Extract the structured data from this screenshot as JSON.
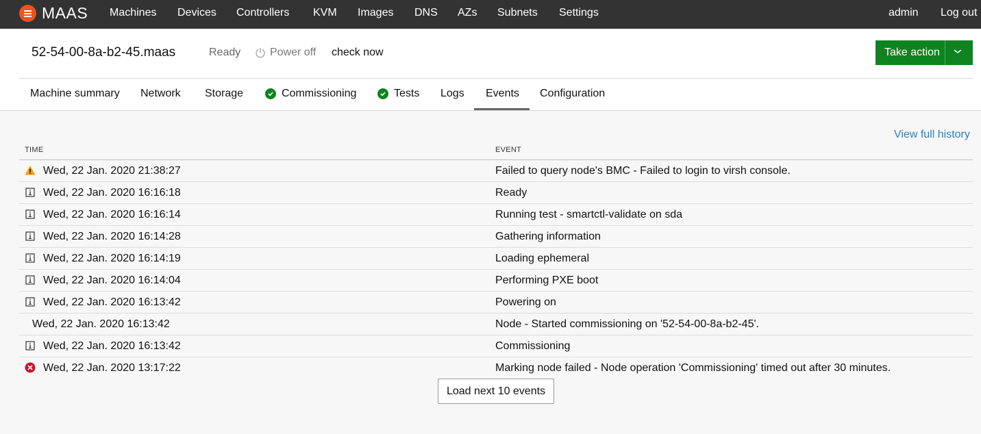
{
  "nav": {
    "brand": "MAAS",
    "items": [
      "Machines",
      "Devices",
      "Controllers",
      "KVM",
      "Images",
      "DNS",
      "AZs",
      "Subnets",
      "Settings"
    ],
    "user": "admin",
    "logout": "Log out"
  },
  "machine": {
    "hostname": "52-54-00-8a-b2-45.maas",
    "status": "Ready",
    "power": "Power off",
    "check_now": "check now",
    "take_action": "Take action"
  },
  "tabs": [
    {
      "label": "Machine summary",
      "icon": ""
    },
    {
      "label": "Network",
      "icon": ""
    },
    {
      "label": "Storage",
      "icon": ""
    },
    {
      "label": "Commissioning",
      "icon": "success-icon"
    },
    {
      "label": "Tests",
      "icon": "success-icon"
    },
    {
      "label": "Logs",
      "icon": ""
    },
    {
      "label": "Events",
      "icon": "",
      "active": true
    },
    {
      "label": "Configuration",
      "icon": ""
    }
  ],
  "events": {
    "view_full_history": "View full history",
    "headers": {
      "time": "TIME",
      "event": "EVENT"
    },
    "rows": [
      {
        "level": "warning",
        "time": "Wed, 22 Jan. 2020 21:38:27",
        "event": "Failed to query node's BMC - Failed to login to virsh console."
      },
      {
        "level": "info",
        "time": "Wed, 22 Jan. 2020 16:16:18",
        "event": "Ready"
      },
      {
        "level": "info",
        "time": "Wed, 22 Jan. 2020 16:16:14",
        "event": "Running test - smartctl-validate on sda"
      },
      {
        "level": "info",
        "time": "Wed, 22 Jan. 2020 16:14:28",
        "event": "Gathering information"
      },
      {
        "level": "info",
        "time": "Wed, 22 Jan. 2020 16:14:19",
        "event": "Loading ephemeral"
      },
      {
        "level": "info",
        "time": "Wed, 22 Jan. 2020 16:14:04",
        "event": "Performing PXE boot"
      },
      {
        "level": "info",
        "time": "Wed, 22 Jan. 2020 16:13:42",
        "event": "Powering on"
      },
      {
        "level": "none",
        "time": "Wed, 22 Jan. 2020 16:13:42",
        "event": "Node - Started commissioning on '52-54-00-8a-b2-45'."
      },
      {
        "level": "info",
        "time": "Wed, 22 Jan. 2020 16:13:42",
        "event": "Commissioning"
      },
      {
        "level": "error",
        "time": "Wed, 22 Jan. 2020 13:17:22",
        "event": "Marking node failed - Node operation 'Commissioning' timed out after 30 minutes."
      }
    ],
    "load_more": "Load next 10 events"
  },
  "colors": {
    "nav_bg": "#333333",
    "brand": "#e95420",
    "action": "#0e8420",
    "link": "#2c7fb8",
    "warning": "#f99b11",
    "error": "#c7162b"
  }
}
